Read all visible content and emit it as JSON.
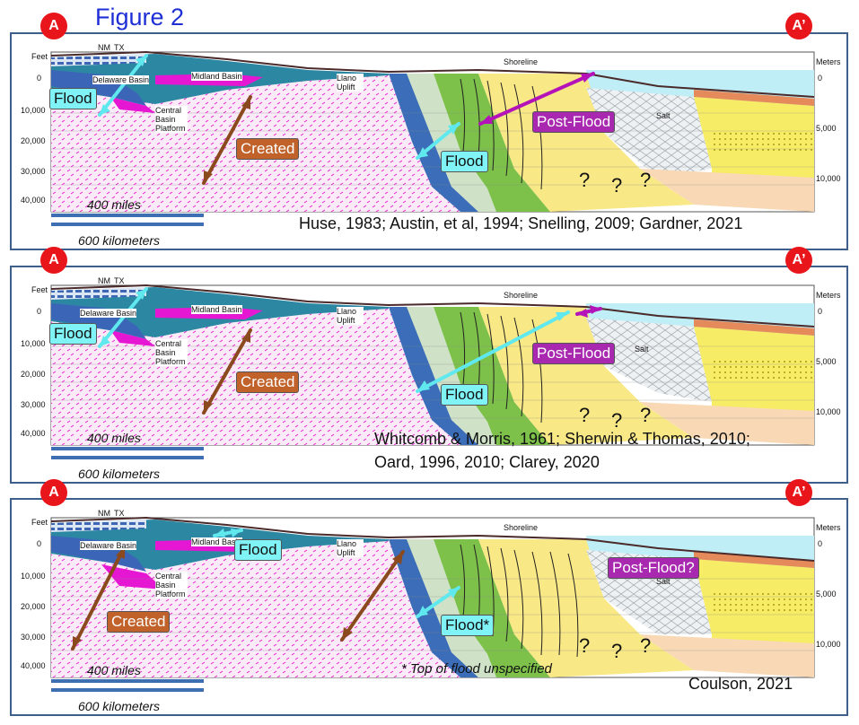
{
  "figure_title": "Figure 2",
  "badge_left": "A",
  "badge_right": "A’",
  "common": {
    "feet": "Feet",
    "meters": "Meters",
    "ft_ticks": [
      "0",
      "10,000",
      "20,000",
      "30,000",
      "40,000"
    ],
    "m_ticks": [
      "0",
      "5,000",
      "10,000"
    ],
    "shoreline": "Shoreline",
    "nm": "NM",
    "tx": "TX",
    "delaware": "Delaware Basin",
    "midland": "Midland Basin",
    "llano": "Llano Uplift",
    "central": "Central Basin Platform",
    "salt": "Salt",
    "q": "?",
    "scale_miles": "400 miles",
    "scale_km": "600 kilometers"
  },
  "panels": [
    {
      "labels": {
        "flood_a": "Flood",
        "created": "Created",
        "flood_b": "Flood",
        "post": "Post-Flood"
      },
      "citation": [
        "Huse, 1983; Austin, et al, 1994; Snelling, 2009; Gardner, 2021"
      ]
    },
    {
      "labels": {
        "flood_a": "Flood",
        "created": "Created",
        "flood_b": "Flood",
        "post": "Post-Flood"
      },
      "citation": [
        "Whitcomb & Morris, 1961; Sherwin & Thomas, 2010;",
        "Oard, 1996, 2010; Clarey, 2020"
      ]
    },
    {
      "labels": {
        "flood_a": "Flood",
        "created": "Created",
        "flood_b": "Flood*",
        "post": "Post-Flood?"
      },
      "note": "* Top of flood unspecified",
      "citation": [
        "Coulson, 2021"
      ]
    }
  ],
  "colors": {
    "flood": "#7ff3f6",
    "created": "#c0622a",
    "post": "#a828b0",
    "badge": "#e8151b",
    "title": "#1f2fd6"
  }
}
